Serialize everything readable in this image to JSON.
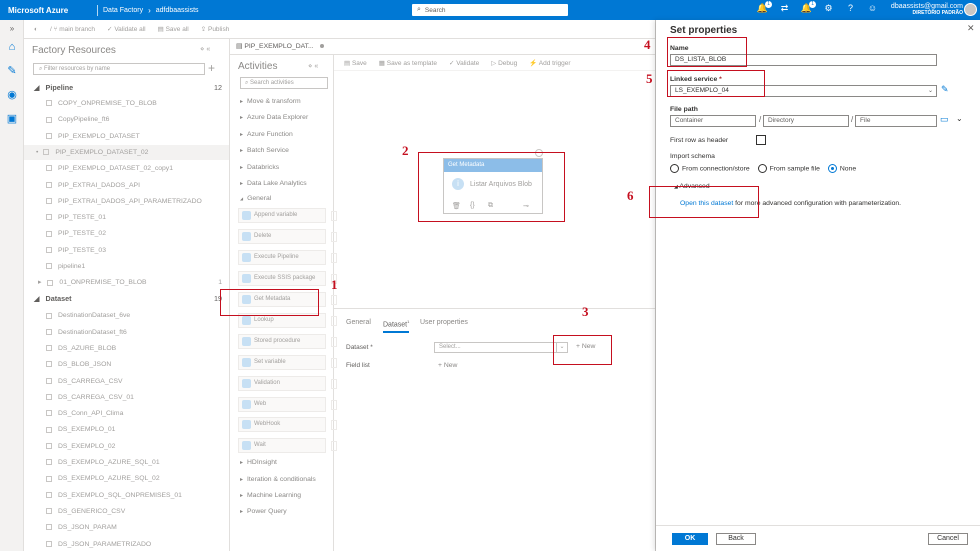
{
  "topbar": {
    "brand": "Microsoft Azure",
    "crumb1": "Data Factory",
    "crumb2": "adfdbaassists",
    "search_placeholder": "Search",
    "notif_count": "1",
    "alert_count": "1",
    "user_email": "dbaassists@gmail.com",
    "user_directory": "DIRETÓRIO PADRÃO"
  },
  "toolbar": {
    "branch": "main branch",
    "validate_all": "Validate all",
    "save_all": "Save all",
    "publish": "Publish"
  },
  "factory": {
    "title": "Factory Resources",
    "filter_placeholder": "Filter resources by name",
    "pipeline_label": "Pipeline",
    "pipeline_count": "12",
    "pipelines": [
      "COPY_ONPREMISE_TO_BLOB",
      "CopyPipeline_ft6",
      "PIP_EXEMPLO_DATASET",
      "PIP_EXEMPLO_DATASET_02",
      "PIP_EXEMPLO_DATASET_02_copy1",
      "PIP_EXTRAI_DADOS_API",
      "PIP_EXTRAI_DADOS_API_PARAMETRIZADO",
      "PIP_TESTE_01",
      "PIP_TESTE_02",
      "PIP_TESTE_03",
      "pipeline1"
    ],
    "folder": "01_ONPREMISE_TO_BLOB",
    "folder_count": "1",
    "dataset_label": "Dataset",
    "dataset_count": "19",
    "datasets": [
      "DestinationDataset_6ve",
      "DestinationDataset_ft6",
      "DS_AZURE_BLOB",
      "DS_BLOB_JSON",
      "DS_CARREGA_CSV",
      "DS_CARREGA_CSV_01",
      "DS_Conn_API_Clima",
      "DS_EXEMPLO_01",
      "DS_EXEMPLO_02",
      "DS_EXEMPLO_AZURE_SQL_01",
      "DS_EXEMPLO_AZURE_SQL_02",
      "DS_EXEMPLO_SQL_ONPREMISES_01",
      "DS_GENERICO_CSV",
      "DS_JSON_PARAM",
      "DS_JSON_PARAMETRIZADO"
    ]
  },
  "editor": {
    "tab_label": "PIP_EXEMPLO_DAT...",
    "canvas_save": "Save",
    "canvas_save_template": "Save as template",
    "canvas_validate": "Validate",
    "canvas_debug": "Debug",
    "canvas_trigger": "Add trigger"
  },
  "activities": {
    "title": "Activities",
    "search_placeholder": "Search activities",
    "categories_top": [
      "Move & transform",
      "Azure Data Explorer",
      "Azure Function",
      "Batch Service",
      "Databricks",
      "Data Lake Analytics"
    ],
    "general_label": "General",
    "general_items": [
      "Append variable",
      "Delete",
      "Execute Pipeline",
      "Execute SSIS package",
      "Get Metadata",
      "Lookup",
      "Stored procedure",
      "Set variable",
      "Validation",
      "Web",
      "WebHook",
      "Wait"
    ],
    "categories_bottom": [
      "HDInsight",
      "Iteration & conditionals",
      "Machine Learning",
      "Power Query"
    ]
  },
  "node": {
    "header": "Get Metadata",
    "name": "Listar Arquivos Blob"
  },
  "bottom": {
    "tab_general": "General",
    "tab_dataset": "Dataset",
    "tab_dataset_badge": "1",
    "tab_user_props": "User properties",
    "dataset_label": "Dataset",
    "dataset_required": "*",
    "dataset_placeholder": "Select...",
    "new_label": "New",
    "field_list_label": "Field list",
    "field_new_label": "New"
  },
  "annotations": [
    "1",
    "2",
    "3",
    "4",
    "5",
    "6"
  ],
  "panel": {
    "title": "Set properties",
    "name_label": "Name",
    "name_value": "DS_LISTA_BLOB",
    "linked_label": "Linked service",
    "linked_required": "*",
    "linked_value": "LS_EXEMPLO_04",
    "filepath_label": "File path",
    "container_ph": "Container",
    "directory_ph": "Directory",
    "file_ph": "File",
    "first_row_label": "First row as header",
    "import_label": "Import schema",
    "radio_conn": "From connection/store",
    "radio_sample": "From sample file",
    "radio_none": "None",
    "advanced_label": "Advanced",
    "advanced_link": "Open this dataset",
    "advanced_text": " for more advanced configuration with parameterization.",
    "ok": "OK",
    "back": "Back",
    "cancel": "Cancel"
  }
}
